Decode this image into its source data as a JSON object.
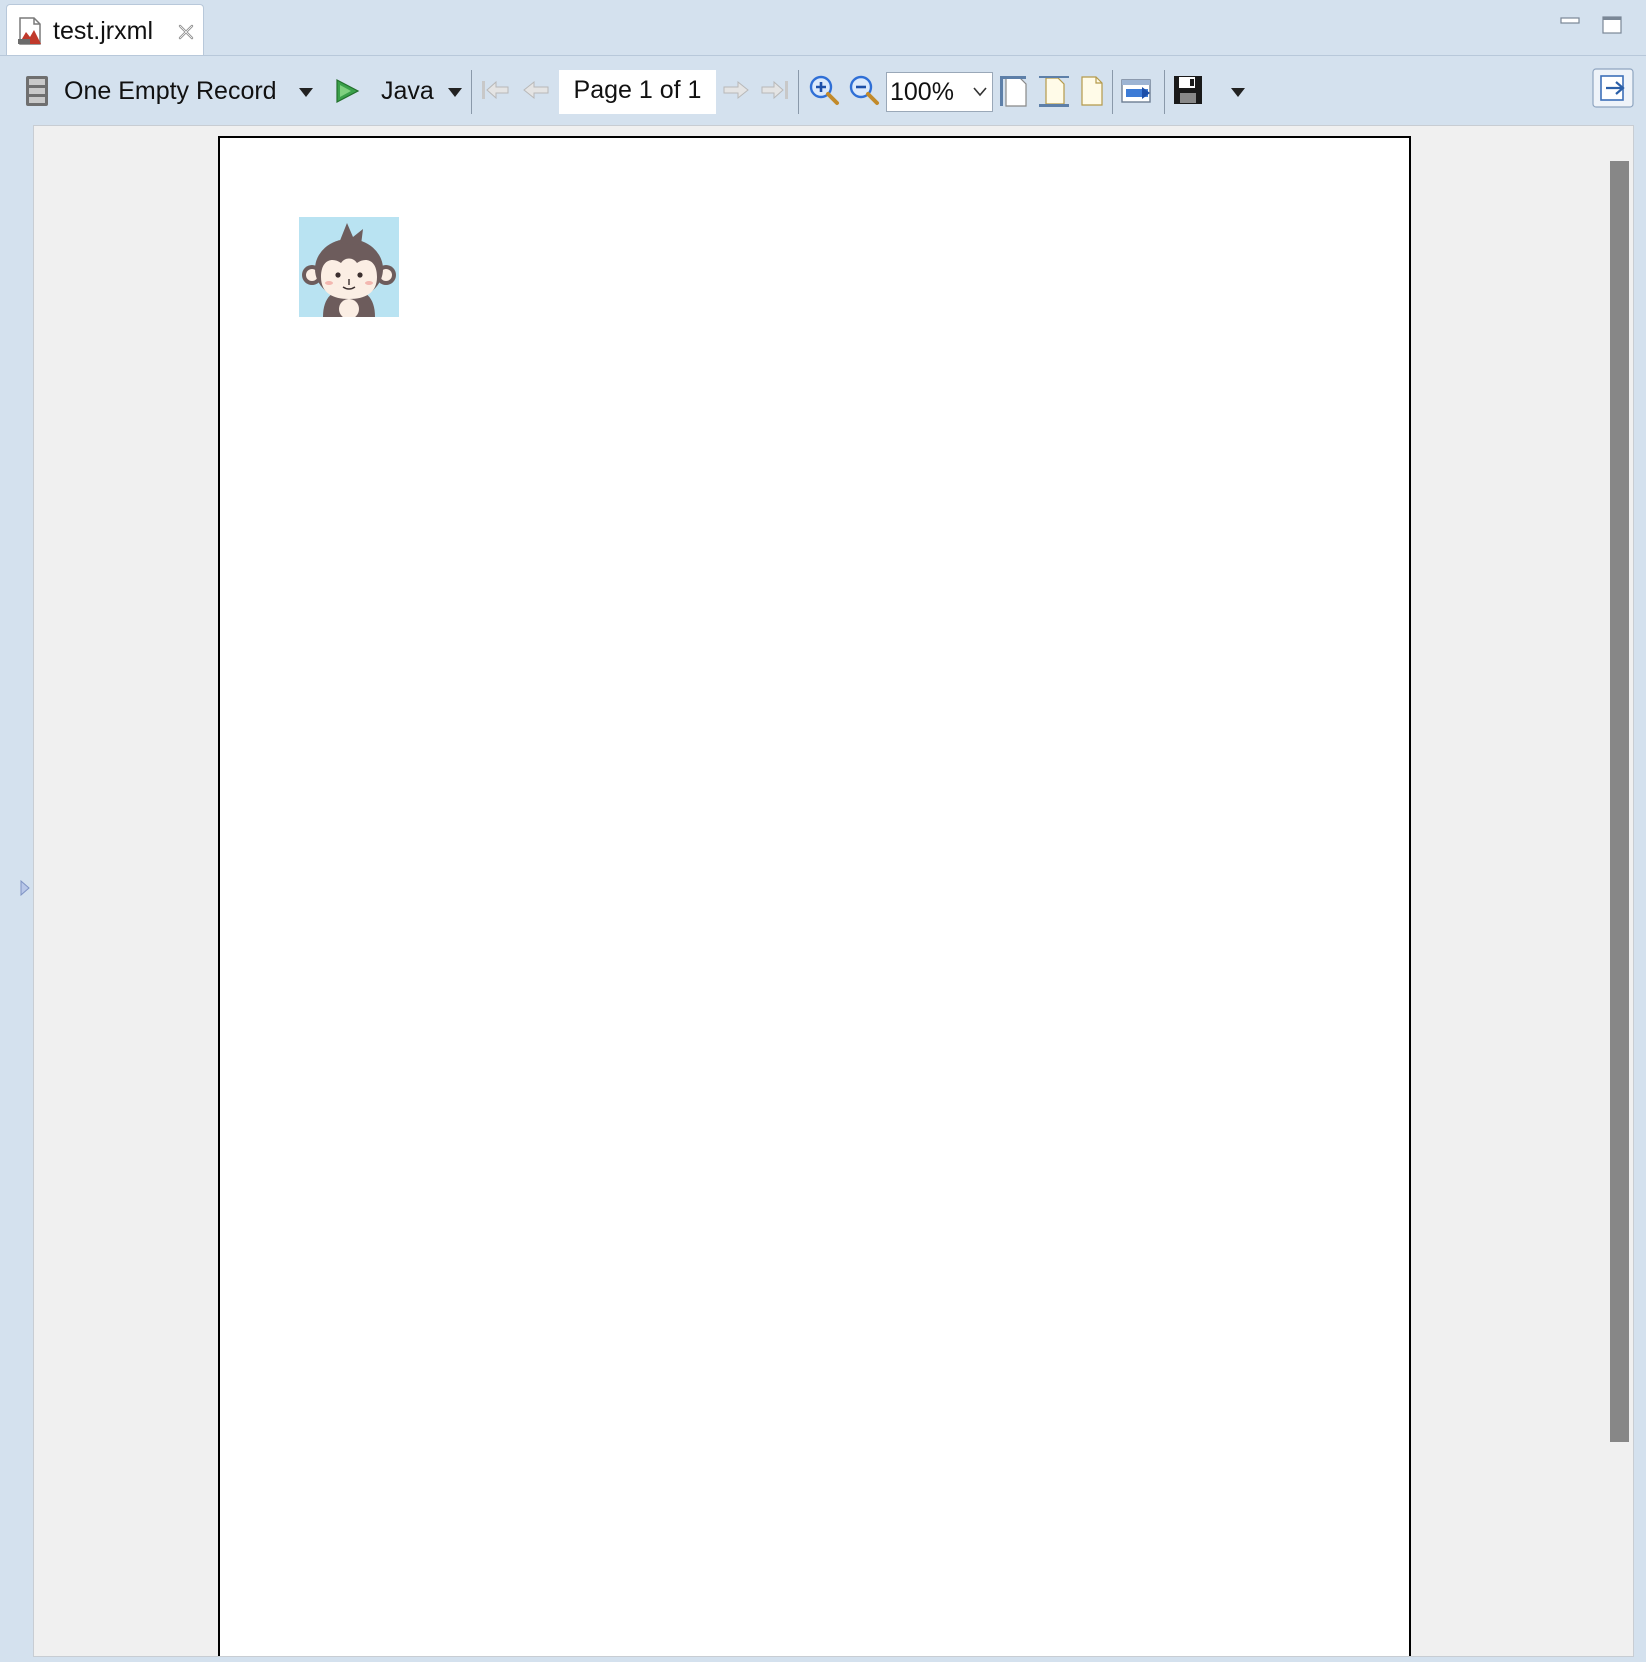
{
  "tab": {
    "title": "test.jrxml",
    "icon": "jrxml-file-icon",
    "close_icon": "close-icon"
  },
  "window_controls": {
    "minimize_icon": "minimize-icon",
    "maximize_icon": "maximize-icon"
  },
  "toolbar": {
    "datasource_icon": "database-icon",
    "datasource_label": "One Empty Record",
    "run_icon": "run-icon",
    "language_label": "Java",
    "first_page_icon": "first-page-icon",
    "prev_page_icon": "previous-page-icon",
    "page_indicator": "Page 1 of 1",
    "next_page_icon": "next-page-icon",
    "last_page_icon": "last-page-icon",
    "zoom_in_icon": "zoom-in-icon",
    "zoom_out_icon": "zoom-out-icon",
    "zoom_value": "100%",
    "fit_page_icon": "fit-page-icon",
    "fit_width_icon": "fit-width-icon",
    "actual_size_icon": "actual-size-icon",
    "export_icon": "export-icon",
    "save_icon": "save-icon",
    "save_menu_icon": "dropdown-arrow-icon",
    "switch_view_icon": "switch-view-icon"
  },
  "report": {
    "image": "monkey-avatar-image"
  },
  "colors": {
    "chrome": "#d4e1ee",
    "canvas": "#f0f0f0",
    "page": "#ffffff",
    "scrollbar_thumb": "#878787",
    "image_background": "#b9e3f2"
  }
}
